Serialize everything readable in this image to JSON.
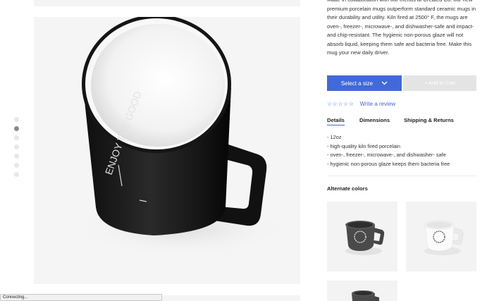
{
  "product": {
    "description": "Made in collaboration with our friends at Created Co. our new premium porcelain mugs outperform standard ceramic mugs in their durability and utility. Kiln fired at 2500° F, the mugs are oven-, freezer-, microwave-, and dishwasher-safe and impact- and chip-resistant. The hygienic non-porous glaze will not absorb liquid, keeping them safe and bacteria free. Make this mug your new daily driver.",
    "select_size_label": "Select a size",
    "add_to_cart_label": "+ Add to Cart",
    "stars": "☆☆☆☆☆",
    "write_review_label": "Write a review"
  },
  "tabs": {
    "details": "Details",
    "dimensions": "Dimensions",
    "shipping": "Shipping & Returns"
  },
  "details": [
    "- 12oz",
    "- high-quality kiln fired porcelain",
    "- oven-, freezer-, microwave-, and dishwasher- safe",
    "- hygienic non-porous glaze keeps them bacteria free"
  ],
  "alternate_colors": {
    "title": "Alternate colors"
  },
  "status_bar": "Connecting...",
  "mug_text": "ENJOY THE GOOD",
  "colors": {
    "accent": "#4169d8",
    "mug_dark": "#1d1d1d",
    "cart_disabled": "#e4e4e4"
  },
  "carousel": {
    "total": 7,
    "active": 2
  }
}
